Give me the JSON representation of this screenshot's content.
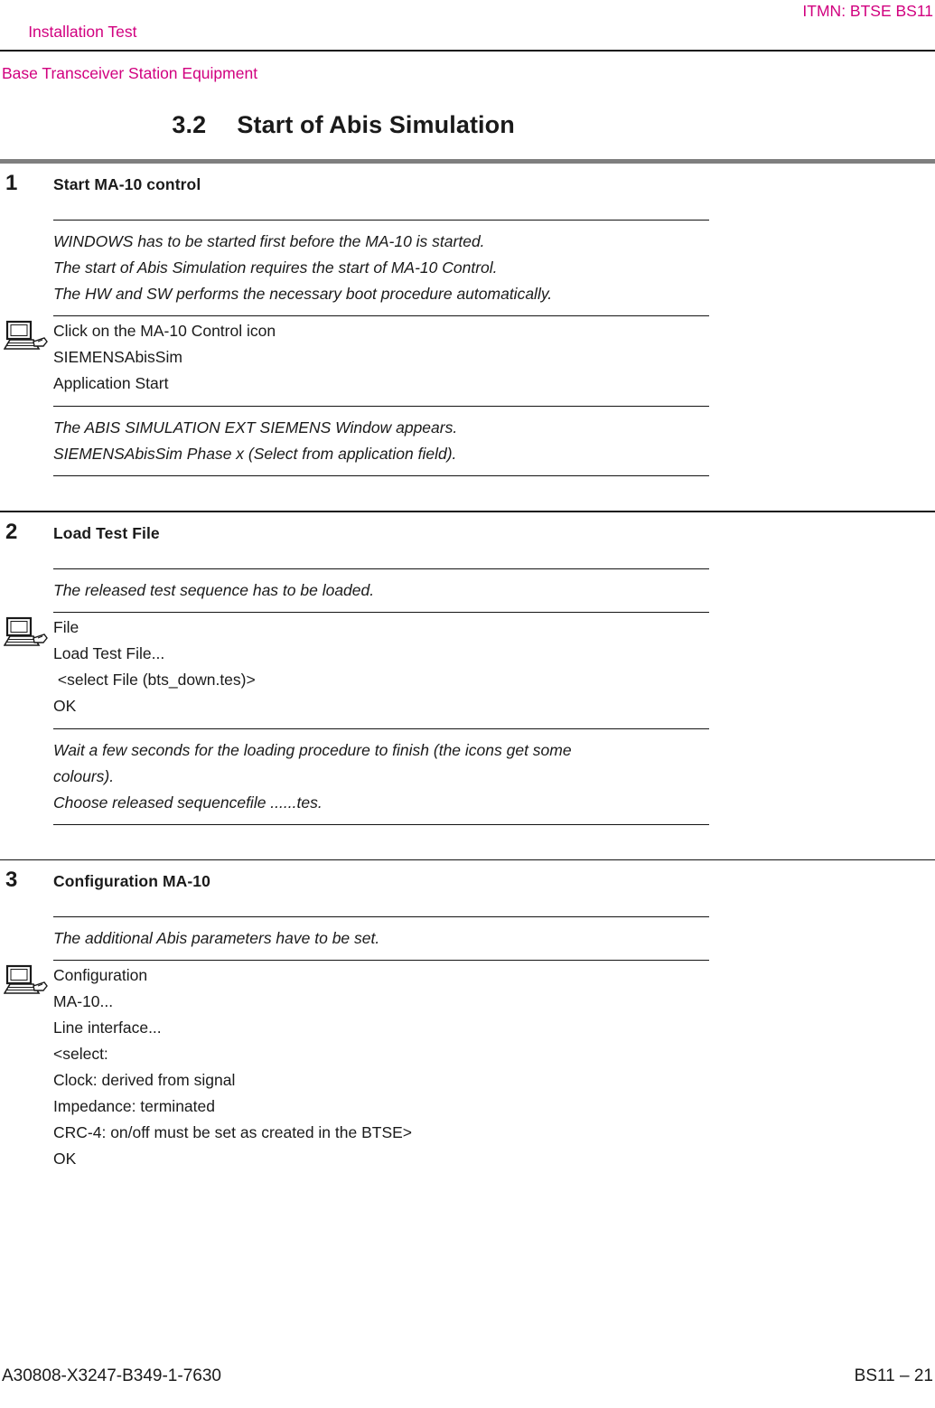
{
  "header": {
    "left_line1": "Installation Test",
    "left_line2": "Base Transceiver Station Equipment",
    "right": "ITMN: BTSE BS11",
    "color": "#d1007f"
  },
  "title": {
    "number": "3.2",
    "text": "Start of Abis Simulation"
  },
  "steps": [
    {
      "number": "1",
      "title": "Start MA-10 control",
      "note_lines": [
        "WINDOWS has to be started first before the MA-10 is started.",
        "The start of Abis Simulation requires the start of MA-10 Control.",
        "The HW and SW performs the necessary boot procedure automatically."
      ],
      "action_icon": "computer-hand-icon",
      "action_lines": [
        "Click on the MA-10 Control icon",
        "SIEMENSAbisSim",
        "Application Start"
      ],
      "result_lines": [
        "The ABIS SIMULATION EXT SIEMENS Window appears.",
        "SIEMENSAbisSim Phase x (Select from application field)."
      ]
    },
    {
      "number": "2",
      "title": "Load Test File",
      "note_lines": [
        "The released test sequence has to be loaded."
      ],
      "action_icon": "computer-hand-icon",
      "action_lines": [
        "File",
        "Load Test File...",
        " <select File (bts_down.tes)>",
        "OK"
      ],
      "result_lines": [
        "Wait a few seconds for the loading procedure to finish (the icons get some",
        "colours).",
        "Choose released sequencefile ......tes."
      ]
    },
    {
      "number": "3",
      "title": "Configuration MA-10",
      "note_lines": [
        "The additional Abis parameters have to be set."
      ],
      "action_icon": "computer-hand-icon",
      "action_lines": [
        "Configuration",
        "MA-10...",
        "Line interface...",
        "<select:",
        "Clock: derived from signal",
        "Impedance: terminated",
        "CRC-4: on/off must be set as created in the BTSE>",
        "OK"
      ],
      "result_lines": []
    }
  ],
  "footer": {
    "left": "A30808-X3247-B349-1-7630",
    "right": "BS11 – 21"
  }
}
